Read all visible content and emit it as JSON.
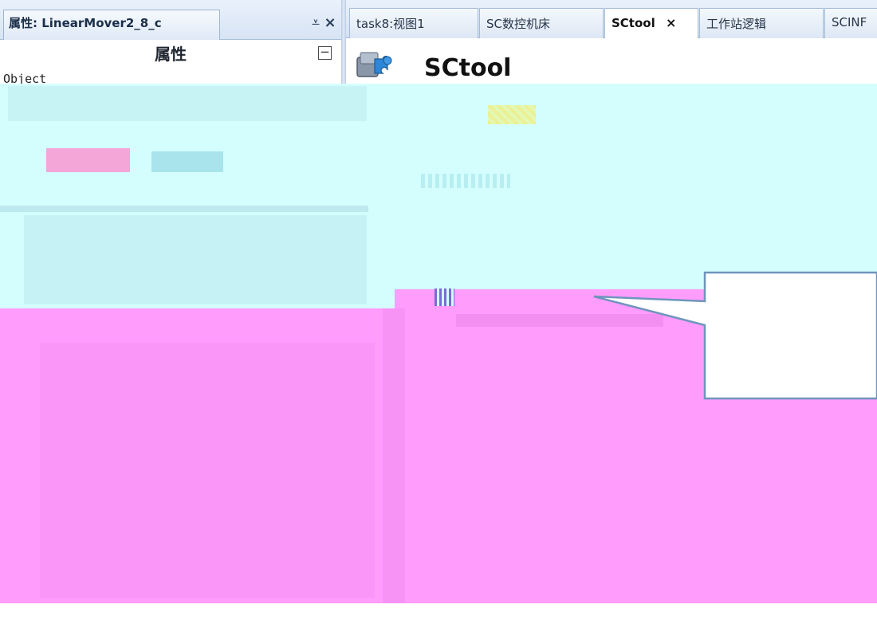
{
  "properties_panel": {
    "tab_title": "属性: LinearMover2_8_c",
    "pin_glyph": "⩡",
    "close_glyph": "×",
    "section_title": "属性",
    "collapse_glyph": "⊟",
    "object_label": "Object"
  },
  "document_tabs": [
    {
      "label": "task8:视图1",
      "active": false,
      "closable": false
    },
    {
      "label": "SC数控机床",
      "active": false,
      "closable": false
    },
    {
      "label": "SCtool",
      "active": true,
      "closable": true,
      "close_glyph": "×"
    },
    {
      "label": "工作站逻辑",
      "active": false,
      "closable": false
    },
    {
      "label": "SCINF",
      "active": false,
      "closable": false
    }
  ],
  "document": {
    "heading": "SCtool",
    "icon": "component-puzzle-icon"
  },
  "colors": {
    "panel_header": "#d7e4f4",
    "tab_border": "#a6bcd8",
    "corruption_cyan": "#d4fefe",
    "corruption_magenta": "#ff9cfc",
    "callout_border": "#6f95bd"
  }
}
